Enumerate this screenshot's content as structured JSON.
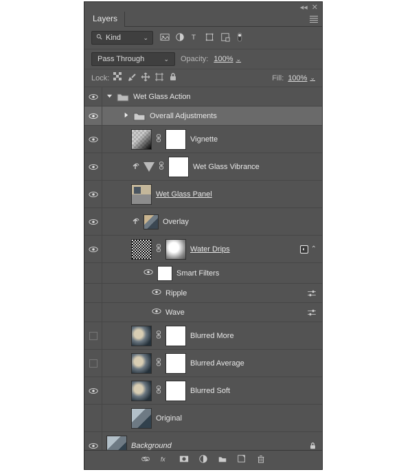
{
  "panel": {
    "title": "Layers"
  },
  "filter": {
    "kind": "Kind"
  },
  "blend": {
    "mode_label": "Pass Through",
    "opacity_label": "Opacity:",
    "opacity_value": "100%"
  },
  "lock": {
    "label": "Lock:",
    "fill_label": "Fill:",
    "fill_value": "100%"
  },
  "layers": {
    "group": "Wet Glass Action",
    "overall": "Overall Adjustments",
    "vignette": "Vignette",
    "vibrance": "Wet Glass Vibrance",
    "panel": "Wet Glass Panel ",
    "overlay": "Overlay",
    "drips": "Water Drips ",
    "smart": "Smart Filters",
    "ripple": "Ripple",
    "wave": "Wave",
    "blur_more": "Blurred More",
    "blur_avg": "Blurred Average",
    "blur_soft": "Blurred Soft",
    "original": "Original",
    "background": "Background"
  }
}
